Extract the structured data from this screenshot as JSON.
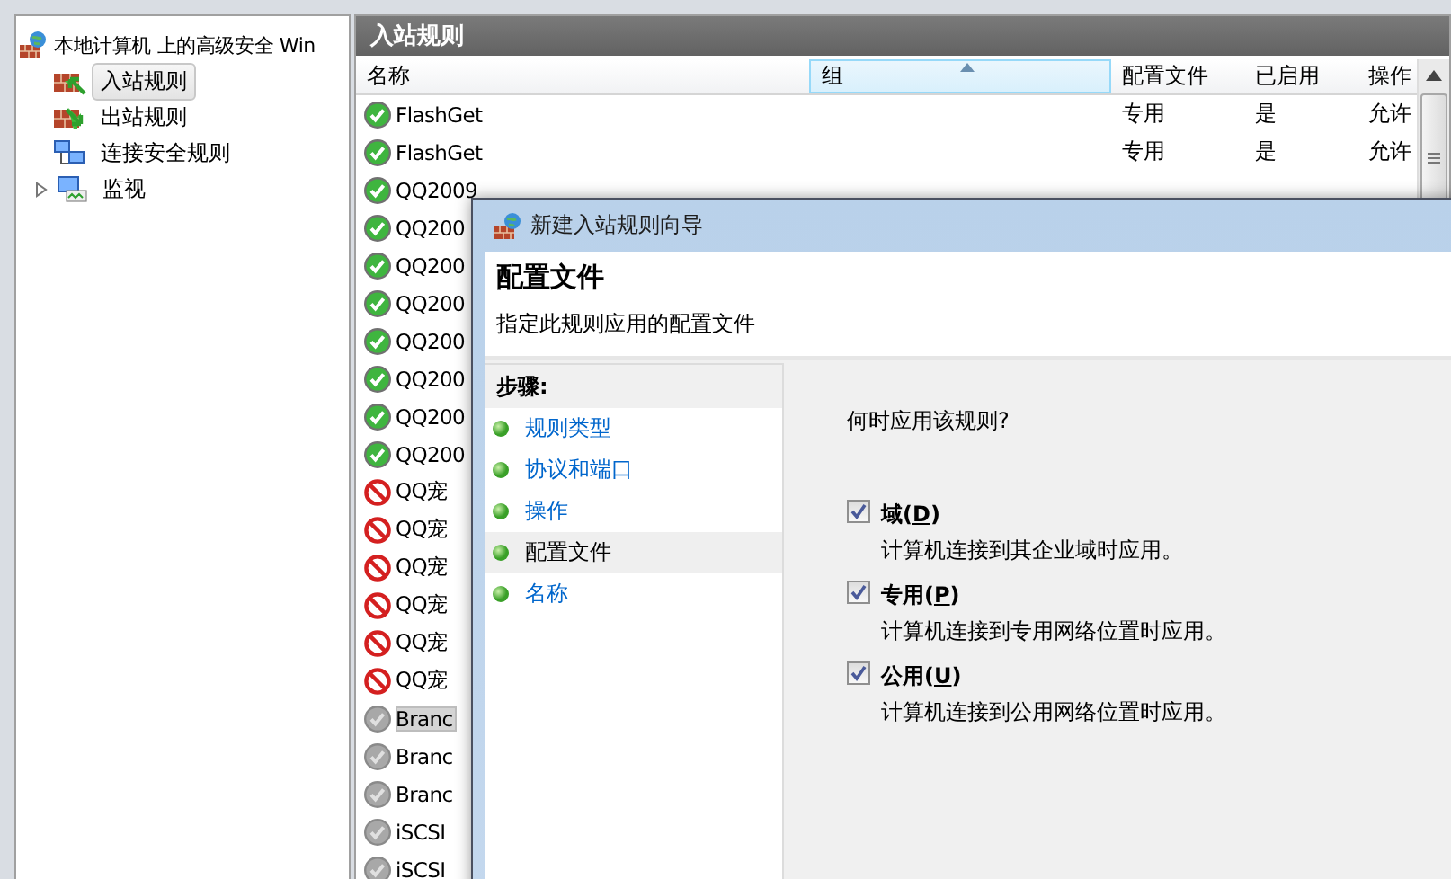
{
  "tree": {
    "label": "本地计算机 上的高级安全 Win",
    "children": [
      {
        "label": "入站规则",
        "kind": "inbound",
        "selected": true
      },
      {
        "label": "出站规则",
        "kind": "outbound",
        "selected": false
      },
      {
        "label": "连接安全规则",
        "kind": "connection",
        "selected": false
      },
      {
        "label": "监视",
        "kind": "monitor",
        "selected": false,
        "expanded": false
      }
    ]
  },
  "panel": {
    "title": "入站规则"
  },
  "table": {
    "columns": [
      {
        "label": "名称",
        "sorted": false
      },
      {
        "label": "组",
        "sorted": true
      },
      {
        "label": "配置文件",
        "sorted": false
      },
      {
        "label": "已启用",
        "sorted": false
      },
      {
        "label": "操作",
        "sorted": false
      }
    ],
    "rows": [
      {
        "name": "FlashGet",
        "kind": "allowed",
        "selected": false,
        "profile": "专用",
        "enabled": "是",
        "action": "允许"
      },
      {
        "name": "FlashGet",
        "kind": "allowed",
        "selected": false,
        "profile": "专用",
        "enabled": "是",
        "action": "允许"
      },
      {
        "name": "QQ2009",
        "kind": "allowed",
        "selected": false
      },
      {
        "name": "QQ200",
        "kind": "allowed",
        "selected": false
      },
      {
        "name": "QQ200",
        "kind": "allowed",
        "selected": false
      },
      {
        "name": "QQ200",
        "kind": "allowed",
        "selected": false
      },
      {
        "name": "QQ200",
        "kind": "allowed",
        "selected": false
      },
      {
        "name": "QQ200",
        "kind": "allowed",
        "selected": false
      },
      {
        "name": "QQ200",
        "kind": "allowed",
        "selected": false
      },
      {
        "name": "QQ200",
        "kind": "allowed",
        "selected": false
      },
      {
        "name": "QQ宠",
        "kind": "blocked",
        "selected": false
      },
      {
        "name": "QQ宠",
        "kind": "blocked",
        "selected": false
      },
      {
        "name": "QQ宠",
        "kind": "blocked",
        "selected": false
      },
      {
        "name": "QQ宠",
        "kind": "blocked",
        "selected": false
      },
      {
        "name": "QQ宠",
        "kind": "blocked",
        "selected": false
      },
      {
        "name": "QQ宠",
        "kind": "blocked",
        "selected": false
      },
      {
        "name": "Branc",
        "kind": "disabled",
        "selected": true
      },
      {
        "name": "Branc",
        "kind": "disabled",
        "selected": false
      },
      {
        "name": "Branc",
        "kind": "disabled",
        "selected": false
      },
      {
        "name": "iSCSI",
        "kind": "disabled",
        "selected": false
      },
      {
        "name": "iSCSI",
        "kind": "disabled",
        "selected": false
      }
    ]
  },
  "dialog": {
    "title": "新建入站规则向导",
    "heading": "配置文件",
    "subheading": "指定此规则应用的配置文件",
    "steps_title": "步骤:",
    "steps": [
      {
        "label": "规则类型",
        "selected": false
      },
      {
        "label": "协议和端口",
        "selected": false
      },
      {
        "label": "操作",
        "selected": false
      },
      {
        "label": "配置文件",
        "selected": true
      },
      {
        "label": "名称",
        "selected": false
      }
    ],
    "question": "何时应用该规则?",
    "options": [
      {
        "label": "域(",
        "access_key": "D",
        "label_end": ")",
        "checked": true,
        "description": "计算机连接到其企业域时应用。"
      },
      {
        "label": "专用(",
        "access_key": "P",
        "label_end": ")",
        "checked": true,
        "description": "计算机连接到专用网络位置时应用。"
      },
      {
        "label": "公用(",
        "access_key": "U",
        "label_end": ")",
        "checked": true,
        "description": "计算机连接到公用网络位置时应用。"
      }
    ]
  }
}
